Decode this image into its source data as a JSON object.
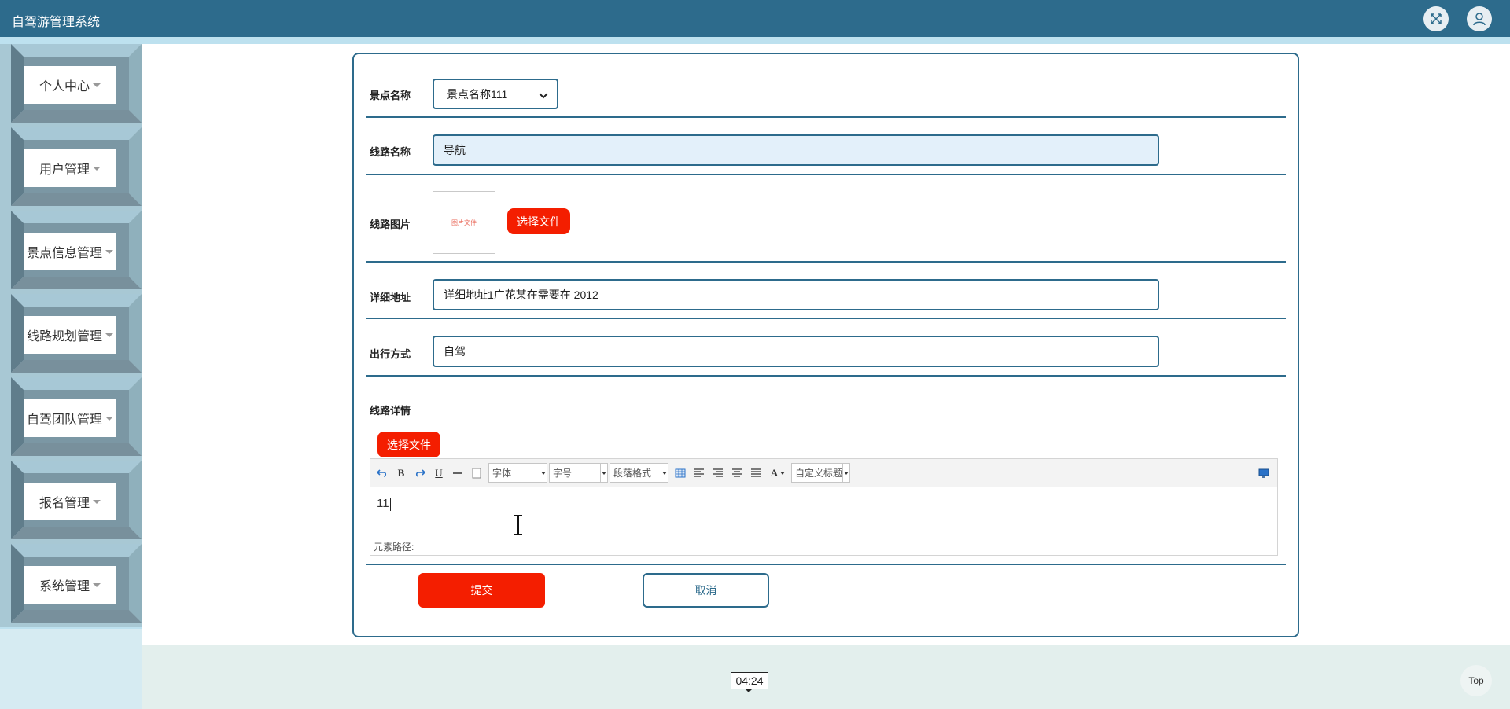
{
  "app": {
    "title": "自驾游管理系统"
  },
  "header": {
    "fullscreen_icon": "expand-arrows-icon",
    "user_icon": "user-icon"
  },
  "sidebar": {
    "items": [
      {
        "label": "个人中心"
      },
      {
        "label": "用户管理"
      },
      {
        "label": "景点信息管理"
      },
      {
        "label": "线路规划管理"
      },
      {
        "label": "自驾团队管理"
      },
      {
        "label": "报名管理"
      },
      {
        "label": "系统管理"
      }
    ]
  },
  "form": {
    "scenic_name": {
      "label": "景点名称",
      "value": "景点名称111"
    },
    "route_name": {
      "label": "线路名称",
      "value": "导航"
    },
    "route_image": {
      "label": "线路图片",
      "thumb_text": "图片文件",
      "button": "选择文件"
    },
    "address": {
      "label": "详细地址",
      "value": "详细地址1广花某在需要在 2012"
    },
    "travel_mode": {
      "label": "出行方式",
      "value": "自驾"
    },
    "route_detail": {
      "label": "线路详情",
      "upload_button": "选择文件"
    },
    "editor": {
      "toolbar": {
        "font_family": "字体",
        "font_size": "字号",
        "paragraph": "段落格式",
        "custom_heading": "自定义标题",
        "bold": "B",
        "underline": "U",
        "font_color": "A"
      },
      "content": "11",
      "element_path": "元素路径:"
    },
    "submit": "提交",
    "cancel": "取消"
  },
  "footer": {
    "timer": "04:24",
    "top_button": "Top"
  },
  "colors": {
    "primary": "#2d6b8c",
    "accent_red": "#f41e00",
    "sidebar_bg": "#bde1ef"
  }
}
